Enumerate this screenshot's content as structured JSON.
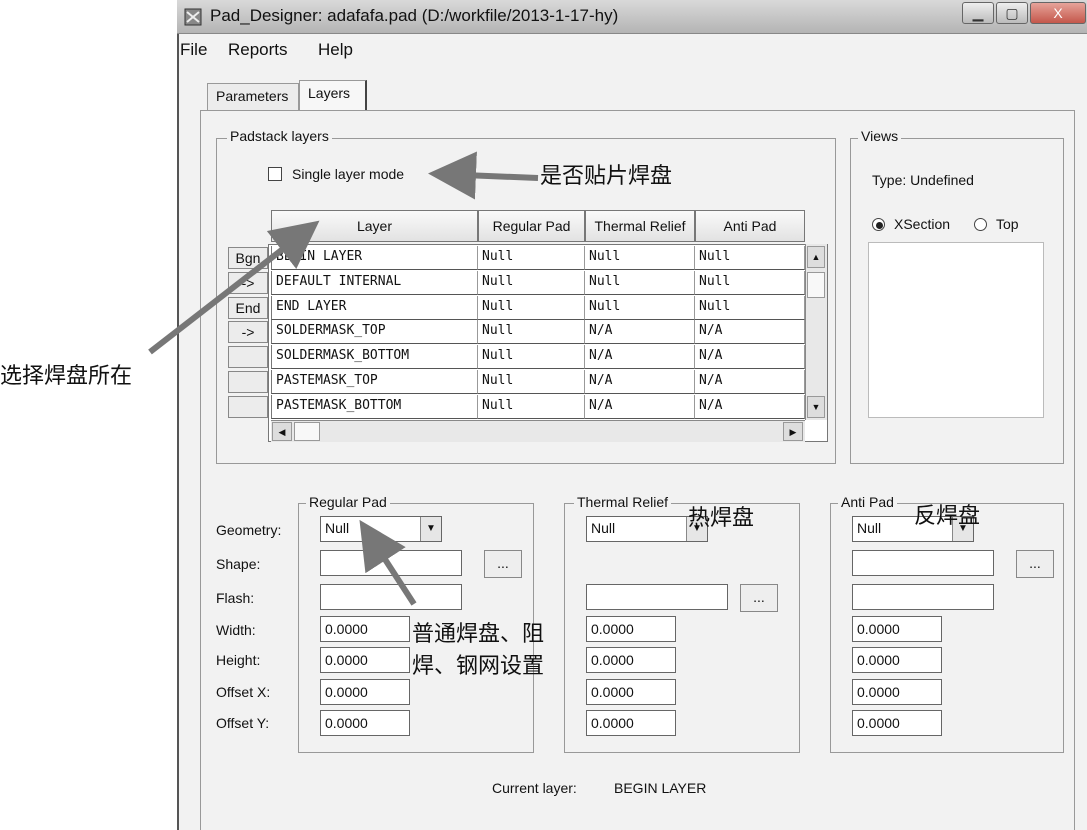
{
  "window": {
    "title": "Pad_Designer: adafafa.pad (D:/workfile/2013-1-17-hy)",
    "controls": [
      "minimize-icon",
      "maximize-icon",
      "close-icon"
    ]
  },
  "menu": [
    "File",
    "Reports",
    "Help"
  ],
  "tabs": [
    {
      "label": "Parameters",
      "active": false
    },
    {
      "label": "Layers",
      "active": true
    }
  ],
  "padstack": {
    "group_label": "Padstack layers",
    "single_layer_mode_label": "Single layer mode",
    "single_layer_mode_checked": false,
    "columns": [
      "Layer",
      "Regular Pad",
      "Thermal Relief",
      "Anti Pad"
    ],
    "rows": [
      {
        "btn": "Bgn",
        "cells": [
          "BEGIN LAYER",
          "Null",
          "Null",
          "Null"
        ]
      },
      {
        "btn": "->",
        "cells": [
          "DEFAULT INTERNAL",
          "Null",
          "Null",
          "Null"
        ]
      },
      {
        "btn": "End",
        "cells": [
          "END LAYER",
          "Null",
          "Null",
          "Null"
        ]
      },
      {
        "btn": "->",
        "cells": [
          "SOLDERMASK_TOP",
          "Null",
          "N/A",
          "N/A"
        ]
      },
      {
        "btn": "",
        "cells": [
          "SOLDERMASK_BOTTOM",
          "Null",
          "N/A",
          "N/A"
        ]
      },
      {
        "btn": "",
        "cells": [
          "PASTEMASK_TOP",
          "Null",
          "N/A",
          "N/A"
        ]
      },
      {
        "btn": "",
        "cells": [
          "PASTEMASK_BOTTOM",
          "Null",
          "N/A",
          "N/A"
        ]
      }
    ]
  },
  "views": {
    "group_label": "Views",
    "type_text": "Type:  Undefined",
    "radio_xsection": "XSection",
    "radio_top": "Top",
    "selected": "XSection"
  },
  "pad_labels": {
    "geometry": "Geometry:",
    "shape": "Shape:",
    "flash": "Flash:",
    "width": "Width:",
    "height": "Height:",
    "offset_x": "Offset X:",
    "offset_y": "Offset Y:"
  },
  "regular_pad": {
    "group_label": "Regular Pad",
    "geometry": "Null",
    "width": "0.0000",
    "height": "0.0000",
    "offset_x": "0.0000",
    "offset_y": "0.0000"
  },
  "thermal_relief": {
    "group_label": "Thermal Relief",
    "geometry": "Null",
    "width": "0.0000",
    "height": "0.0000",
    "offset_x": "0.0000",
    "offset_y": "0.0000"
  },
  "anti_pad": {
    "group_label": "Anti Pad",
    "geometry": "Null",
    "width": "0.0000",
    "height": "0.0000",
    "offset_x": "0.0000",
    "offset_y": "0.0000"
  },
  "browse_button_label": "...",
  "current_layer": {
    "label": "Current layer:",
    "value": "BEGIN LAYER"
  },
  "annotations": {
    "smd": "是否贴片焊盘",
    "select_layer": "选择焊盘所在",
    "thermal": "热焊盘",
    "anti": "反焊盘",
    "regular_line1": "普通焊盘、阻",
    "regular_line2": "焊、钢网设置"
  }
}
